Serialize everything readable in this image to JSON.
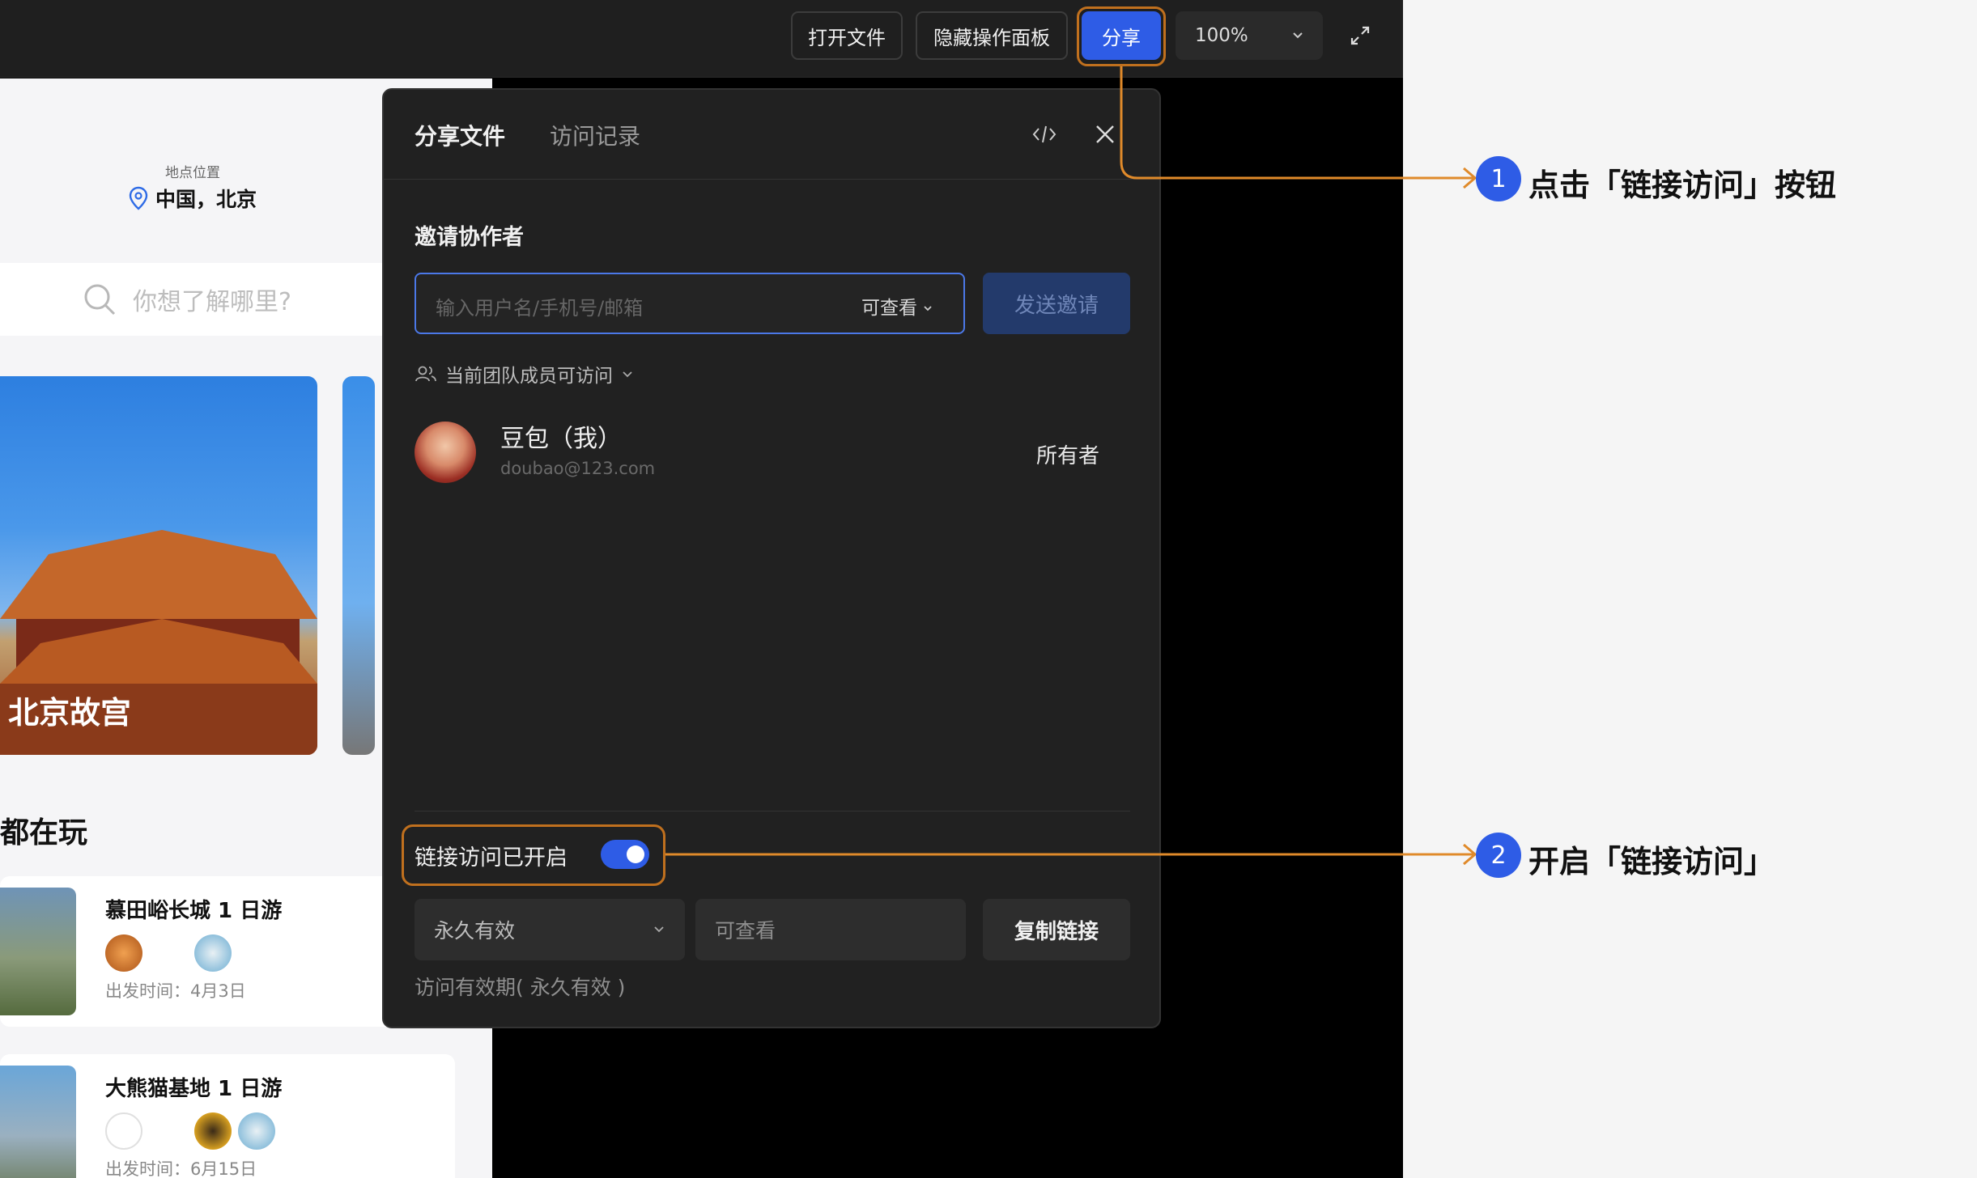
{
  "toolbar": {
    "open_file": "打开文件",
    "hide_panel": "隐藏操作面板",
    "share": "分享",
    "zoom": "100%"
  },
  "preview": {
    "location_label": "地点位置",
    "location": "中国，北京",
    "search_placeholder": "你想了解哪里?",
    "card_title": "北京故宫",
    "section_title": "都在玩",
    "trips": [
      {
        "title": "慕田峪长城 1 日游",
        "date": "出发时间：4月3日"
      },
      {
        "title": "大熊猫基地 1 日游",
        "date": "出发时间：6月15日"
      }
    ]
  },
  "dialog": {
    "tab_share": "分享文件",
    "tab_history": "访问记录",
    "invite_title": "邀请协作者",
    "invite_placeholder": "输入用户名/手机号/邮箱",
    "invite_permission": "可查看",
    "send_invite": "发送邀请",
    "team_access": "当前团队成员可访问",
    "owner": {
      "name": "豆包（我）",
      "email": "doubao@123.com",
      "role": "所有者"
    },
    "link_access_label": "链接访问已开启",
    "link_access_enabled": true,
    "expiry_option": "永久有效",
    "link_permission": "可查看",
    "copy_link": "复制链接",
    "expiry_note": "访问有效期( 永久有效 )"
  },
  "annotations": [
    {
      "number": "1",
      "text": "点击「链接访问」按钮"
    },
    {
      "number": "2",
      "text": "开启「链接访问」"
    }
  ],
  "colors": {
    "accent": "#2e5ce6",
    "highlight": "#c0701e",
    "dialog_bg": "#212121",
    "topbar_bg": "#1f1f1f"
  }
}
